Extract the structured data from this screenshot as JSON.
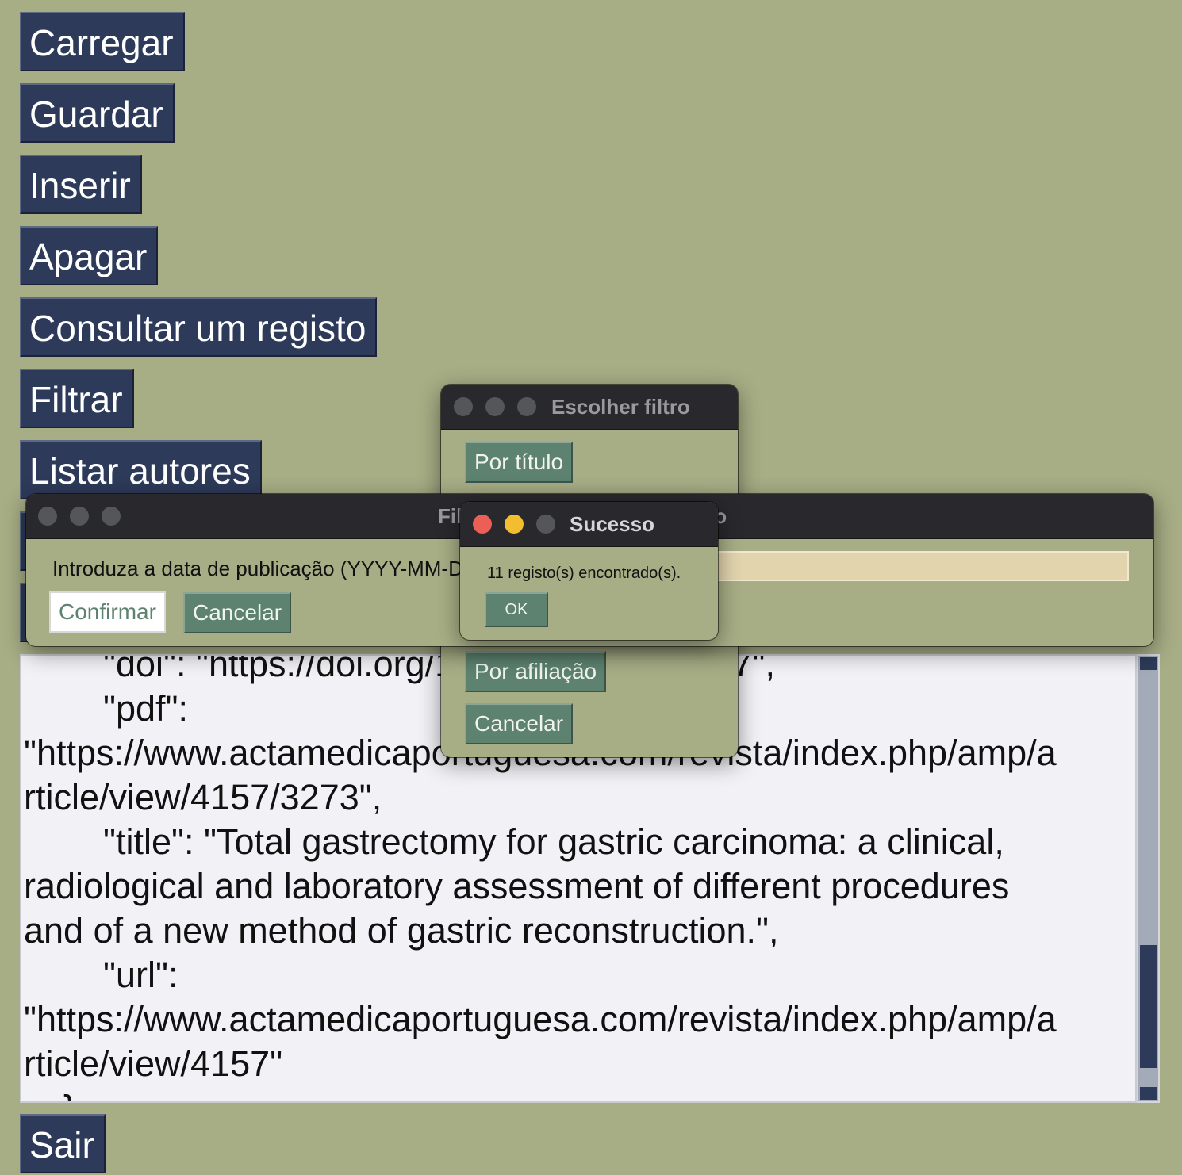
{
  "menu": {
    "carregar": "Carregar",
    "guardar": "Guardar",
    "inserir": "Inserir",
    "apagar": "Apagar",
    "consultar": "Consultar um registo",
    "filtrar": "Filtrar",
    "listar_autores": "Listar autores",
    "sair": "Sair"
  },
  "text_area": {
    "lines": [
      "        \"doi\": \"https://doi.org/10.20344/amp.4157\",",
      "        \"pdf\":",
      "\"https://www.actamedicaportuguesa.com/revista/index.php/amp/a",
      "rticle/view/4157/3273\",",
      "        \"title\": \"Total gastrectomy for gastric carcinoma: a clinical,",
      "radiological and laboratory assessment of different procedures",
      "and of a new method of gastric reconstruction.\",",
      "        \"url\":",
      "\"https://www.actamedicaportuguesa.com/revista/index.php/amp/a",
      "rticle/view/4157\"",
      "    }"
    ]
  },
  "filter_dialog": {
    "title": "Escolher filtro",
    "by_title": "Por título",
    "by_affiliation": "Por afiliação",
    "cancel": "Cancelar"
  },
  "date_dialog": {
    "title": "Filtrar por data de publicação",
    "prompt": "Introduza a data de publicação (YYYY-MM-DD):",
    "input_value": "",
    "confirm": "Confirmar",
    "cancel": "Cancelar"
  },
  "success_dialog": {
    "title": "Sucesso",
    "message": "11 registo(s) encontrado(s).",
    "ok": "OK"
  },
  "colors": {
    "background": "#a7ad85",
    "main_button": "#2d3a59",
    "dialog_button": "#5d8270",
    "input_field": "#e2d4ad",
    "title_bar": "#29292d"
  }
}
